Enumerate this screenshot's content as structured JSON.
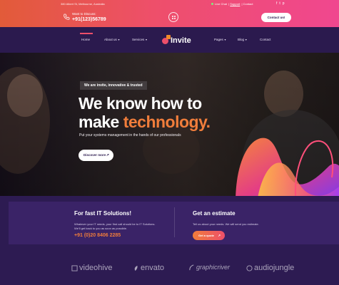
{
  "topbar": {
    "address": "380 Albert St, Melbourne, Australia",
    "call_label": "Want to Discuss:",
    "phone": "+91(123)56789",
    "live_chat": "Live Chat",
    "support": "Support",
    "contact_link": "Contact",
    "social": [
      "f",
      "t",
      "p"
    ],
    "contact_button": "Contact us!"
  },
  "nav": {
    "left": [
      {
        "label": "Home",
        "active": true
      },
      {
        "label": "About us",
        "dropdown": true
      },
      {
        "label": "Services",
        "dropdown": true
      }
    ],
    "logo_text": "Invite",
    "right": [
      {
        "label": "Pages",
        "dropdown": true
      },
      {
        "label": "Blog",
        "dropdown": true
      },
      {
        "label": "Contact"
      }
    ]
  },
  "hero": {
    "badge": "We are invite, innovative & trusted",
    "title_line1": "We know how to",
    "title_line2_plain": "make ",
    "title_line2_accent": "technology.",
    "subtitle": "Put your systems management in the hands of our professionals",
    "button": "Discover more",
    "button_arrow": "↗"
  },
  "info": {
    "left_title": "For fast IT Solutions!",
    "left_text_line1": "Whatever your IT needs, your first call should be to IT Solutions.",
    "left_text_line2": "We'll get back to you as soon as possible.",
    "left_phone": "+91 (0)20 8406 2285",
    "right_title": "Get an estimate",
    "right_text": "Tell us about your needs. We will send you estimate.",
    "right_button": "Get a quote",
    "right_button_arrow": "↗"
  },
  "partners": [
    "videohive",
    "envato",
    "graphicriver",
    "audiojungle"
  ],
  "colors": {
    "brand_dark": "#2b1a4e",
    "accent_orange": "#f07d3b",
    "accent_pink": "#ee4f6a"
  }
}
